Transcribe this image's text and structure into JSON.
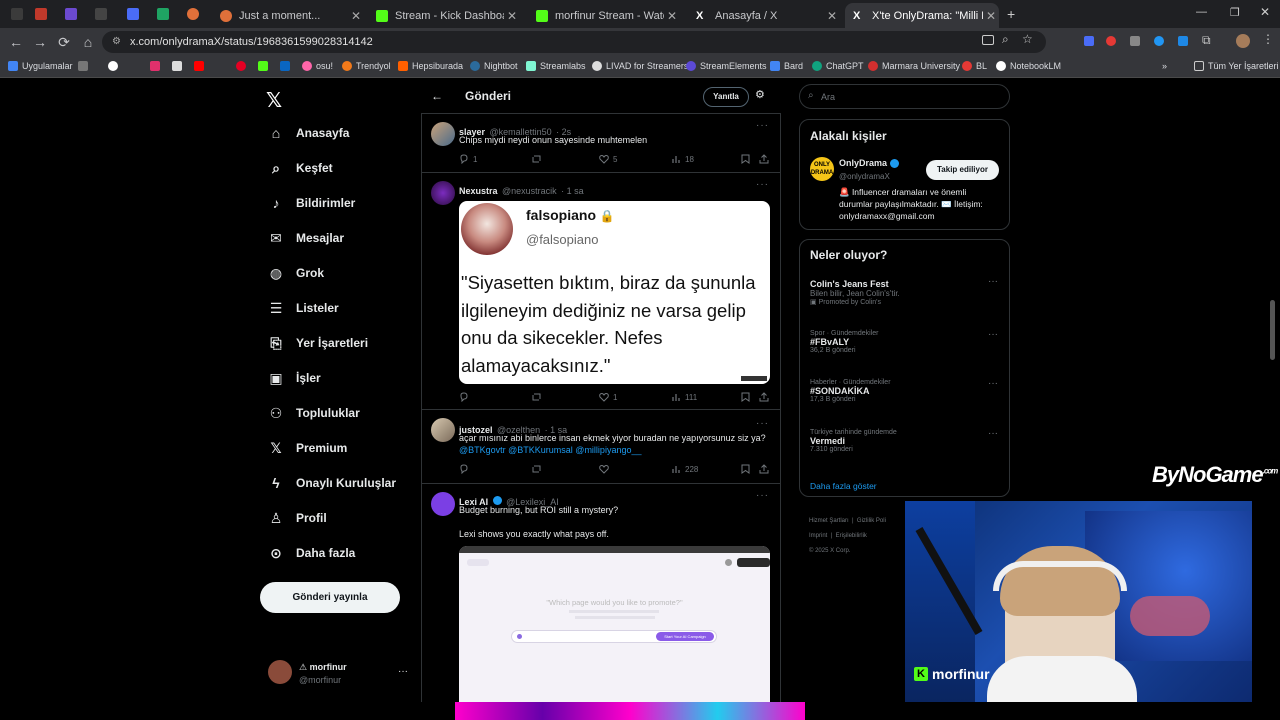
{
  "browser": {
    "tabs": [
      {
        "title": "Just a moment...",
        "color": "#e0703a"
      },
      {
        "title": "Stream - Kick Dashboard",
        "color": "#53fc18"
      },
      {
        "title": "morfinur Stream - Watch Live o",
        "color": "#53fc18"
      },
      {
        "title": "Anasayfa / X",
        "color": "#ffffff"
      },
      {
        "title": "X'te OnlyDrama: \"Milli Piyango",
        "color": "#ffffff"
      }
    ],
    "url": "x.com/onlydramaX/status/1968361599028314142",
    "bookmarks": [
      "Uygulamalar",
      "osu!",
      "Trendyol",
      "Hepsiburada",
      "Nightbot",
      "Streamlabs",
      "LIVAD for Streamers",
      "StreamElements",
      "Bard",
      "ChatGPT",
      "Marmara University",
      "BL",
      "NotebookLM",
      "Tüm Yer İşaretleri"
    ]
  },
  "nav": {
    "items": [
      "Anasayfa",
      "Keşfet",
      "Bildirimler",
      "Mesajlar",
      "Grok",
      "Listeler",
      "Yer İşaretleri",
      "İşler",
      "Topluluklar",
      "Premium",
      "Onaylı Kuruluşlar",
      "Profil",
      "Daha fazla"
    ],
    "post_button": "Gönderi yayınla",
    "account_name": "morfinur",
    "account_handle": "@morfinur"
  },
  "header": {
    "title": "Gönderi",
    "reply_button": "Yanıtla"
  },
  "tweets": [
    {
      "name": "slayer",
      "handle": "@kemallettin50",
      "time": "· 2s",
      "text": "Chips miydi neydi onun sayesinde muhtemelen",
      "replies": "1",
      "retweets": "",
      "likes": "5",
      "views": "18"
    },
    {
      "name": "Nexustra",
      "handle": "@nexustracik",
      "time": "· 1 sa",
      "quote_name": "falsopiano",
      "quote_handle": "@falsopiano",
      "quote_text": "\"Siyasetten bıktım, biraz da şununla ilgileneyim dediğiniz ne varsa gelip onu da sikecekler. Nefes alamayacaksınız.\"",
      "replies": "",
      "retweets": "",
      "likes": "1",
      "views": "111"
    },
    {
      "name": "justozel",
      "handle": "@ozelthen",
      "time": "· 1 sa",
      "text": "açar mısınız abi binlerce insan ekmek yiyor buradan ne yapıyorsunuz siz ya?",
      "mentions": "@BTKgovtr @BTKKurumsal @millipiyango__",
      "replies": "",
      "retweets": "",
      "likes": "",
      "views": "228"
    },
    {
      "name": "Lexi AI",
      "handle": "@Lexilexi_AI",
      "time": "",
      "text": "Budget burning, but ROI still a mystery?",
      "text2": "Lexi shows you exactly what pays off.",
      "embed_prompt": "\"Which page would you like to promote?\"",
      "embed_button": "Start Your AI Campaign"
    }
  ],
  "right": {
    "search_placeholder": "Ara",
    "related_title": "Alakalı kişiler",
    "related_name": "OnlyDrama",
    "related_handle": "@onlydramaX",
    "related_bio": "🚨 Influencer dramaları ve önemli durumlar paylaşılmaktadır. ✉️ İletişim: onlydramaxx@gmail.com",
    "follow_button": "Takip ediliyor",
    "trends_title": "Neler oluyor?",
    "trends": [
      {
        "category": "",
        "name": "Colin's Jeans Fest",
        "detail": "Bilen bilir, Jean Colin's'tir.",
        "extra": "Promoted by Colin's"
      },
      {
        "category": "Spor · Gündemdekiler",
        "name": "#FBvALY",
        "detail": "36,2 B gönderi",
        "extra": ""
      },
      {
        "category": "Haberler · Gündemdekiler",
        "name": "#SONDAKİKA",
        "detail": "17,3 B gönderi",
        "extra": ""
      },
      {
        "category": "Türkiye tarihinde gündemde",
        "name": "Vermedi",
        "detail": "7.310 gönderi",
        "extra": ""
      }
    ],
    "show_more": "Daha fazla göster",
    "footer": [
      "Hizmet Şartları",
      "Gizlilik Poli",
      "Imprint",
      "Erişilebilirlik",
      "© 2025 X Corp."
    ]
  },
  "stream": {
    "watermark": "ByNoGame",
    "watermark_suffix": ".com",
    "streamer": "morfinur"
  }
}
